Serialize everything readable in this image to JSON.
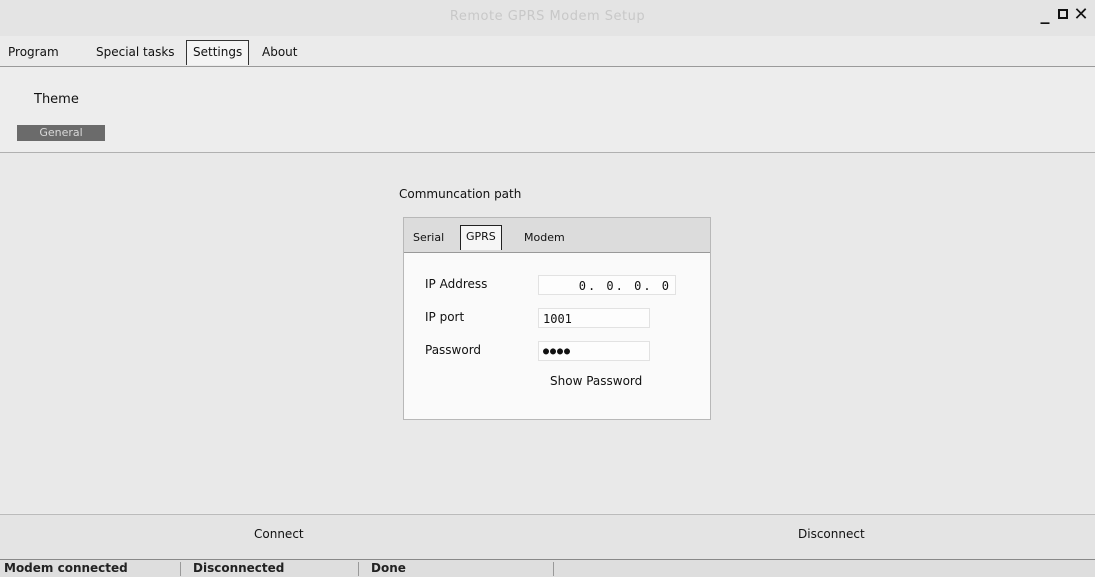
{
  "window": {
    "title": "Remote GPRS Modem Setup"
  },
  "menu": {
    "tabs": [
      {
        "label": "Program",
        "active": false
      },
      {
        "label": "Special tasks",
        "active": false
      },
      {
        "label": "Settings",
        "active": true
      },
      {
        "label": "About",
        "active": false
      }
    ]
  },
  "ribbon": {
    "group_label": "Theme",
    "general_label": "General"
  },
  "comm": {
    "label": "Communcation path",
    "tabs": [
      {
        "label": "Serial",
        "active": false
      },
      {
        "label": "GPRS",
        "active": true
      },
      {
        "label": "Modem",
        "active": false
      }
    ],
    "ip_label": "IP Address",
    "ip_value": "0.  0.  0.  0",
    "port_label": "IP port",
    "port_value": "1001",
    "password_label": "Password",
    "password_value": "●●●●",
    "show_password_label": "Show Password"
  },
  "buttons": {
    "connect": "Connect",
    "disconnect": "Disconnect"
  },
  "status": {
    "modem": "Modem connected",
    "connection": "Disconnected",
    "task": "Done"
  }
}
